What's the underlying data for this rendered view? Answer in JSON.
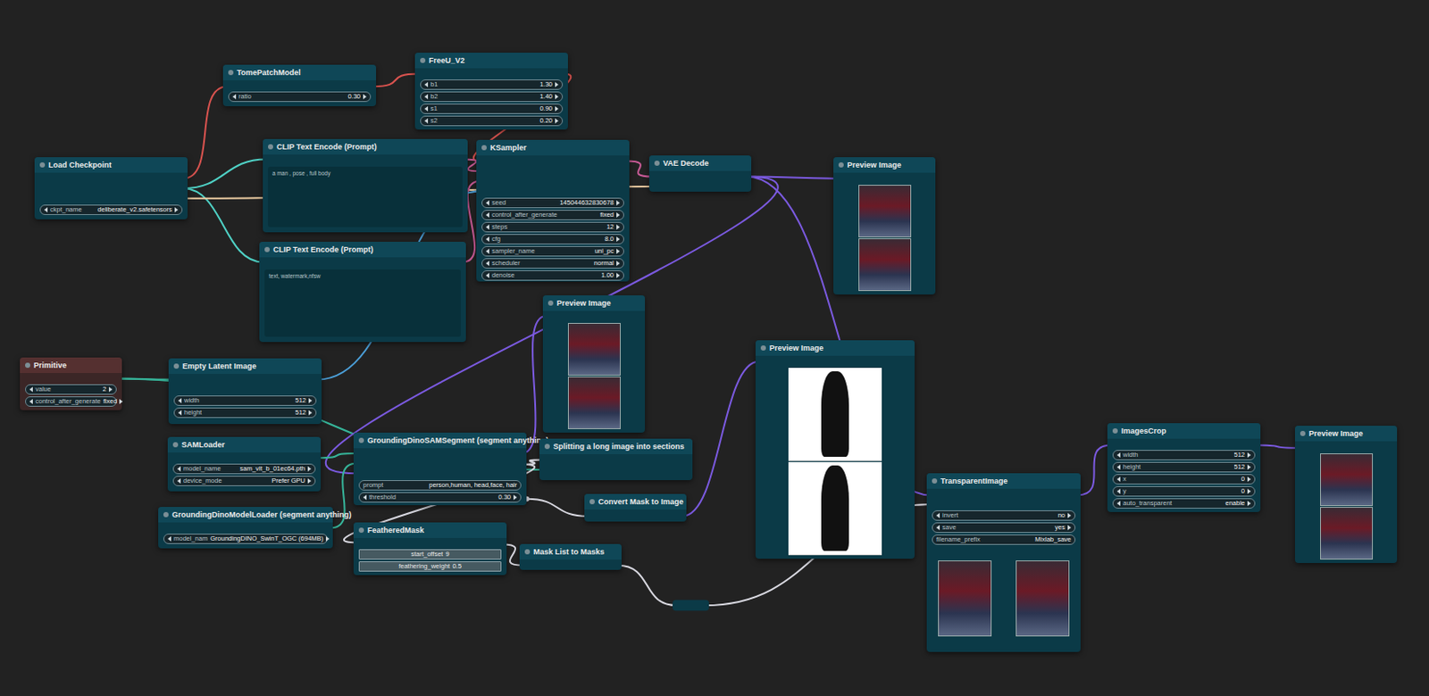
{
  "nodes": [
    {
      "title": "TomePatchModel",
      "kind": "node",
      "widgets": [
        {
          "kind": "number",
          "label": "ratio",
          "value": "0.30"
        }
      ]
    },
    {
      "title": "FreeU_V2",
      "kind": "node",
      "widgets": [
        {
          "kind": "number",
          "label": "b1",
          "value": "1.30"
        },
        {
          "kind": "number",
          "label": "b2",
          "value": "1.40"
        },
        {
          "kind": "number",
          "label": "s1",
          "value": "0.90"
        },
        {
          "kind": "number",
          "label": "s2",
          "value": "0.20"
        }
      ]
    },
    {
      "title": "Load Checkpoint",
      "kind": "node",
      "widgets": [
        {
          "kind": "number",
          "label": "ckpt_name",
          "value": "deliberate_v2.safetensors"
        }
      ]
    },
    {
      "title": "CLIP Text Encode (Prompt)",
      "kind": "textarea",
      "text": "a man , pose , full body"
    },
    {
      "title": "CLIP Text Encode (Prompt)",
      "kind": "textarea",
      "text": "text, watermark,nfsw"
    },
    {
      "title": "KSampler",
      "kind": "node",
      "widgets": [
        {
          "kind": "number",
          "label": "seed",
          "value": "145044632830678"
        },
        {
          "kind": "number",
          "label": "control_after_generate",
          "value": "fixed"
        },
        {
          "kind": "number",
          "label": "steps",
          "value": "12"
        },
        {
          "kind": "number",
          "label": "cfg",
          "value": "8.0"
        },
        {
          "kind": "number",
          "label": "sampler_name",
          "value": "uni_pc"
        },
        {
          "kind": "number",
          "label": "scheduler",
          "value": "normal"
        },
        {
          "kind": "number",
          "label": "denoise",
          "value": "1.00"
        }
      ]
    },
    {
      "title": "VAE Decode",
      "kind": "node",
      "widgets": []
    },
    {
      "title": "Preview Image",
      "kind": "preview",
      "widgets": []
    },
    {
      "title": "Preview Image",
      "kind": "preview",
      "widgets": []
    },
    {
      "title": "Preview Image",
      "kind": "mask-preview",
      "widgets": []
    },
    {
      "title": "Primitive",
      "kind": "primitive",
      "widgets": [
        {
          "kind": "number",
          "label": "value",
          "value": "2"
        },
        {
          "kind": "number",
          "label": "control_after_generate",
          "value": "fixed"
        }
      ]
    },
    {
      "title": "Empty Latent Image",
      "kind": "node",
      "widgets": [
        {
          "kind": "number",
          "label": "width",
          "value": "512"
        },
        {
          "kind": "number",
          "label": "height",
          "value": "512"
        }
      ]
    },
    {
      "title": "SAMLoader",
      "kind": "node",
      "widgets": [
        {
          "kind": "number",
          "label": "model_name",
          "value": "sam_vit_b_01ec64.pth"
        },
        {
          "kind": "number",
          "label": "device_mode",
          "value": "Prefer GPU"
        }
      ]
    },
    {
      "title": "GroundingDinoSAMSegment (segment anything)",
      "kind": "node",
      "widgets": [
        {
          "kind": "text",
          "label": "prompt",
          "value": "person,human, head,face, hair"
        },
        {
          "kind": "number",
          "label": "threshold",
          "value": "0.30"
        }
      ]
    },
    {
      "title": "Splitting a long image into sections",
      "kind": "node",
      "widgets": []
    },
    {
      "title": "GroundingDinoModelLoader (segment anything)",
      "kind": "node",
      "widgets": [
        {
          "kind": "number",
          "label": "model_nam",
          "value": "GroundingDINO_SwinT_OGC (694MB)"
        }
      ]
    },
    {
      "title": "FeatheredMask",
      "kind": "node",
      "widgets": [
        {
          "kind": "slider",
          "label": "start_offset",
          "value": "9"
        },
        {
          "kind": "slider",
          "label": "feathering_weight",
          "value": "0.5"
        }
      ]
    },
    {
      "title": "Convert Mask to Image",
      "kind": "node",
      "widgets": []
    },
    {
      "title": "Mask List to Masks",
      "kind": "node",
      "widgets": []
    },
    {
      "title": "TransparentImage",
      "kind": "node-preview",
      "widgets": [
        {
          "kind": "number",
          "label": "invert",
          "value": "no"
        },
        {
          "kind": "number",
          "label": "save",
          "value": "yes"
        },
        {
          "kind": "text",
          "label": "filename_prefix",
          "value": "Mixlab_save"
        }
      ]
    },
    {
      "title": "ImagesCrop",
      "kind": "node",
      "widgets": [
        {
          "kind": "number",
          "label": "width",
          "value": "512"
        },
        {
          "kind": "number",
          "label": "height",
          "value": "512"
        },
        {
          "kind": "number",
          "label": "x",
          "value": "0"
        },
        {
          "kind": "number",
          "label": "y",
          "value": "0"
        },
        {
          "kind": "number",
          "label": "auto_transparent",
          "value": "enable"
        }
      ]
    },
    {
      "title": "Preview Image",
      "kind": "preview",
      "widgets": []
    }
  ]
}
